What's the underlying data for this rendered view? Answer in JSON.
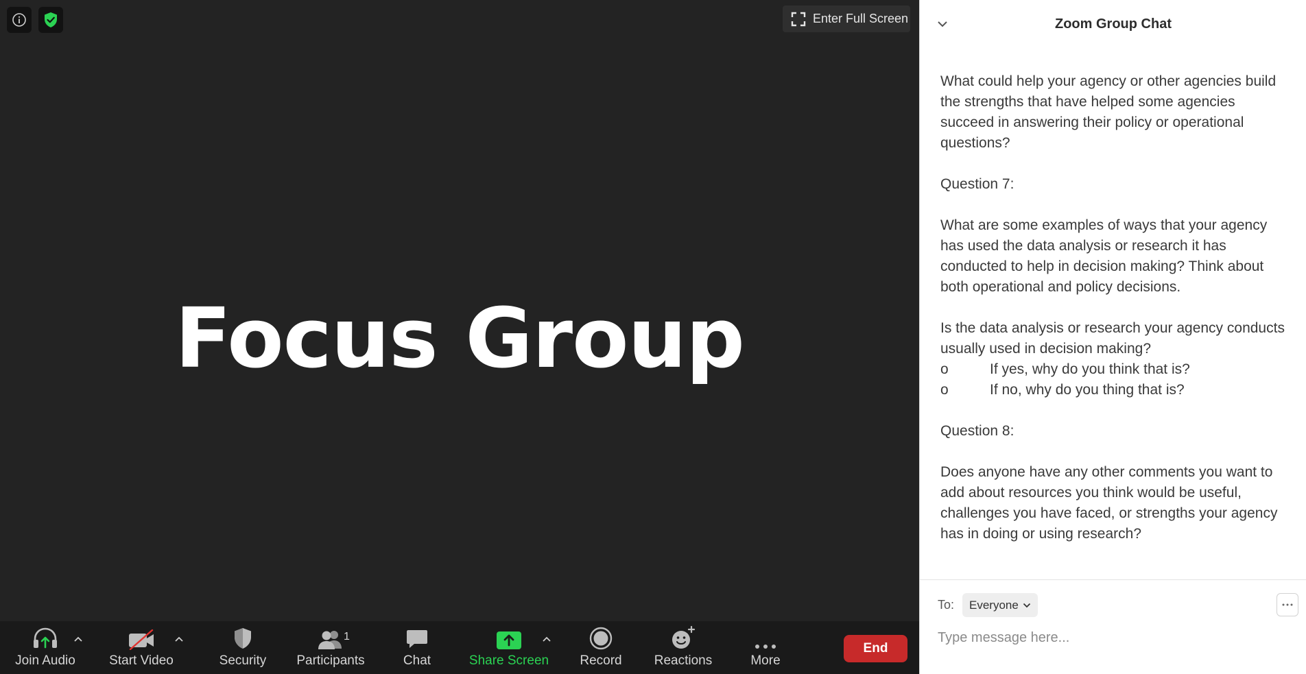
{
  "meeting": {
    "fullscreen_label": "Enter Full Screen",
    "stage_title": "Focus Group"
  },
  "toolbar": {
    "join_audio": "Join Audio",
    "start_video": "Start Video",
    "security": "Security",
    "participants": "Participants",
    "participants_count": "1",
    "chat": "Chat",
    "share_screen": "Share Screen",
    "record": "Record",
    "reactions": "Reactions",
    "more": "More",
    "end": "End"
  },
  "chat": {
    "title": "Zoom Group Chat",
    "messages": {
      "p1": "What could help your agency or other agencies build the strengths that have helped some agencies succeed in answering their policy or operational questions?",
      "q7_heading": "Question 7:",
      "p2": "What are some examples of ways that your agency has used the data analysis or research it has conducted to help in decision making? Think about both operational and policy decisions.",
      "p3": "Is the data analysis or research your agency conducts usually used in decision making?",
      "bullet_marker": "o",
      "bullet1": "If yes, why do you think that is?",
      "bullet2": "If no, why do you thing that is?",
      "q8_heading": "Question 8:",
      "p4": "Does anyone have any other comments you want to add about resources you think would be useful, challenges you have faced, or strengths your agency has in doing or using research?"
    },
    "to_label": "To:",
    "recipient": "Everyone",
    "input_placeholder": "Type message here..."
  },
  "colors": {
    "accent_green": "#2bd253",
    "end_red": "#c72a2a",
    "meeting_bg": "#232323"
  },
  "icons": [
    "info-icon",
    "shield-check-icon",
    "fullscreen-icon",
    "headphones-icon",
    "video-off-icon",
    "shield-icon",
    "participants-icon",
    "chat-bubble-icon",
    "share-screen-icon",
    "record-icon",
    "reactions-icon",
    "more-dots-icon",
    "chevron-down-icon",
    "caret-up-icon"
  ]
}
